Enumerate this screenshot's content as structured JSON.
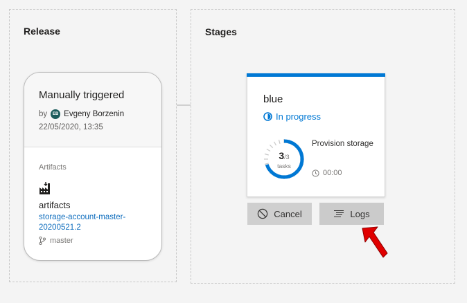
{
  "release": {
    "title": "Release",
    "card": {
      "trigger": "Manually triggered",
      "by": "by",
      "user_initials": "EB",
      "user": "Evgeny Borzenin",
      "date": "22/05/2020, 13:35",
      "artifacts_label": "Artifacts",
      "artifact_icon": "factory-icon",
      "artifact_name": "artifacts",
      "artifact_version": "storage-account-master-20200521.2",
      "branch": "master"
    }
  },
  "stages": {
    "title": "Stages",
    "card": {
      "name": "blue",
      "status": "In progress",
      "tasks_done": "3",
      "tasks_total": "/3",
      "tasks_label": "tasks",
      "progress_fraction": 1.0,
      "task_name": "Provision storage",
      "duration": "00:00"
    },
    "buttons": {
      "cancel": "Cancel",
      "logs": "Logs"
    }
  },
  "colors": {
    "accent": "#0078d4",
    "link": "#106ebe",
    "annotation_arrow": "#e00000"
  }
}
